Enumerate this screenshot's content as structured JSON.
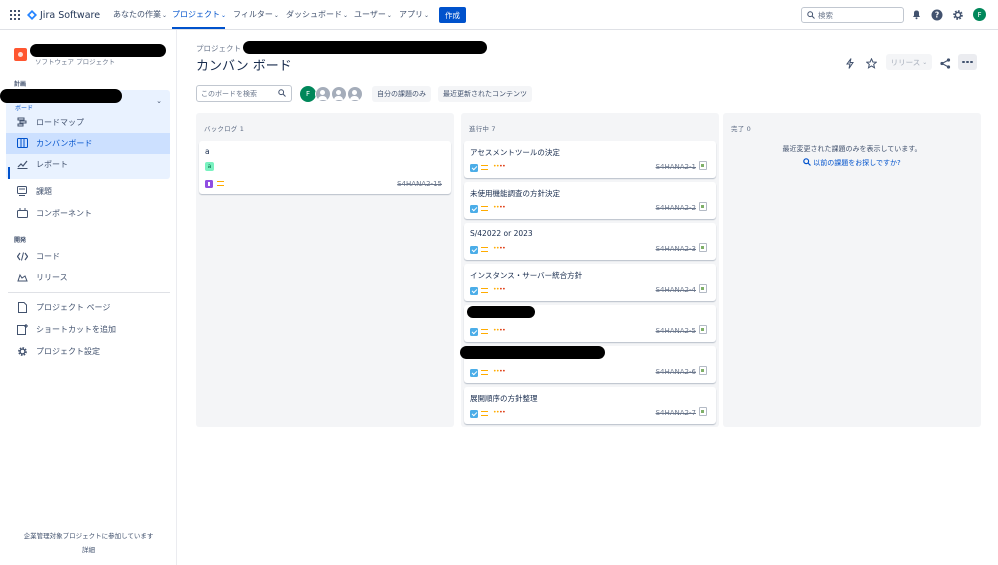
{
  "topbar": {
    "product": "Jira Software",
    "nav": [
      {
        "label": "あなたの作業",
        "chevron": "⌄"
      },
      {
        "label": "プロジェクト",
        "chevron": "⌄"
      },
      {
        "label": "フィルター",
        "chevron": "⌄"
      },
      {
        "label": "ダッシュボード",
        "chevron": "⌄"
      },
      {
        "label": "ユーザー",
        "chevron": "⌄"
      },
      {
        "label": "アプリ",
        "chevron": "⌄"
      }
    ],
    "create_label": "作成",
    "search_placeholder": "検索",
    "avatar_initial": "F",
    "icons": [
      "notifications-icon",
      "help-icon",
      "settings-icon"
    ]
  },
  "sidebar": {
    "project_type": "ソフトウェア プロジェクト",
    "section_planning": "計画",
    "board_group_label": "ボード",
    "items": [
      {
        "label": "ロードマップ",
        "icon": "roadmap-icon"
      },
      {
        "label": "カンバンボード",
        "icon": "board-icon"
      },
      {
        "label": "レポート",
        "icon": "reports-icon"
      },
      {
        "label": "課題",
        "icon": "issues-icon"
      },
      {
        "label": "コンポーネント",
        "icon": "components-icon"
      }
    ],
    "section_dev": "開発",
    "dev_items": [
      {
        "label": "コード",
        "icon": "code-icon"
      },
      {
        "label": "リリース",
        "icon": "release-icon"
      }
    ],
    "bottom_items": [
      {
        "label": "プロジェクト ページ",
        "icon": "page-icon"
      },
      {
        "label": "ショートカットを追加",
        "icon": "add-shortcut-icon"
      },
      {
        "label": "プロジェクト設定",
        "icon": "settings-icon"
      }
    ],
    "footer_text": "企業管理対象プロジェクトに参加しています",
    "footer_link": "詳細"
  },
  "header": {
    "breadcrumb": "プロジェクト",
    "title": "カンバン ボード",
    "release_label": "リリース",
    "release_chevron": "⌄"
  },
  "filters": {
    "search_placeholder": "このボードを検索",
    "avatar_initial": "F",
    "only_my_issues": "自分の課題のみ",
    "recently_updated": "最近更新されたコンテンツ"
  },
  "board": {
    "columns": [
      {
        "title": "バックログ 1"
      },
      {
        "title": "進行中 7"
      },
      {
        "title": "完了 0"
      }
    ],
    "backlog_card": {
      "title": "a",
      "label": "a",
      "key": "S4HANA2-15"
    },
    "in_progress_cards": [
      {
        "title": "アセスメントツールの決定",
        "key": "S4HANA2-1"
      },
      {
        "title": "未使用機能調査の方針決定",
        "key": "S4HANA2-2"
      },
      {
        "title": "S/42022 or 2023",
        "key": "S4HANA2-3"
      },
      {
        "title": "インスタンス・サーバー統合方針",
        "key": "S4HANA2-4"
      },
      {
        "title": "",
        "key": "S4HANA2-5"
      },
      {
        "title": "",
        "key": "S4HANA2-6"
      },
      {
        "title": "展開順序の方針整理",
        "key": "S4HANA2-7"
      }
    ],
    "done_message": "最近変更された課題のみを表示しています。",
    "done_link": "以前の課題をお探しですか?",
    "priority_dots": "••••"
  },
  "colors": {
    "brand": "#0052cc",
    "selected_bg": "#cce0ff",
    "column_bg": "#f4f5f7",
    "task_blue": "#4bade8",
    "priority_medium": "#ffab00",
    "story_purple": "#904ee2",
    "label_green": "#79f2c0"
  }
}
